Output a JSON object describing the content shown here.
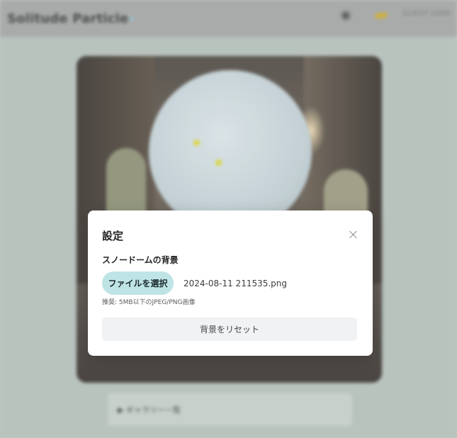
{
  "app": {
    "logo": "Solitude Particle",
    "user_label": "GUEST USER",
    "gallery_toggle": "▶ ギャラリー一覧"
  },
  "icons": {
    "settings": "gear-icon",
    "edit": "pencil-icon",
    "close": "close-icon"
  },
  "modal": {
    "title": "設定",
    "section_label": "スノードームの背景",
    "file_button": "ファイルを選択",
    "file_name": "2024-08-11 211535.png",
    "hint": "推奨: 5MB以下のJPEG/PNG画像",
    "reset_button": "背景をリセット"
  },
  "colors": {
    "file_button_bg": "#bfe4e6",
    "reset_button_bg": "#f1f2f4",
    "particle": "#d9d236"
  }
}
